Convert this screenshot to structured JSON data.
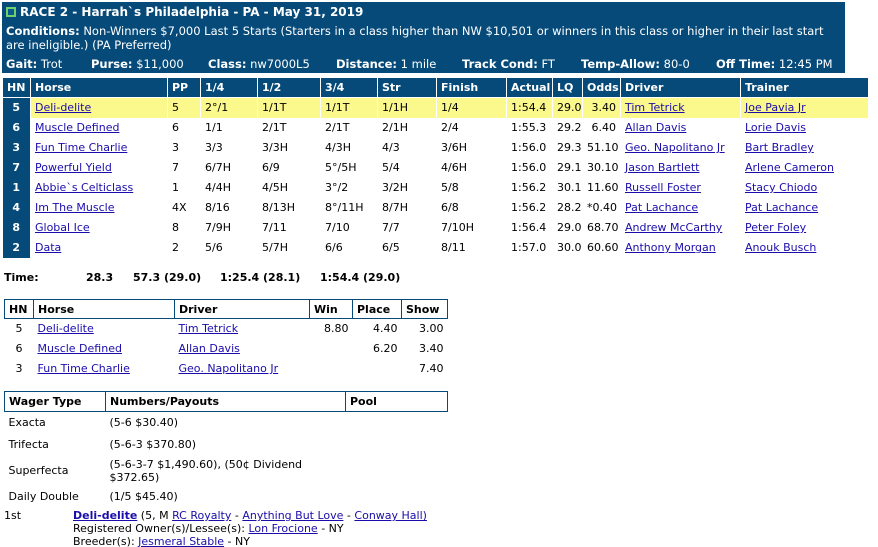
{
  "header": {
    "title": "RACE 2 - Harrah`s Philadelphia - PA - May 31, 2019",
    "conditions_label": "Conditions:",
    "conditions_text": "Non-Winners $7,000 Last 5 Starts (Starters in a class higher than NW $10,501 or winners in this class or higher in their last start are ineligible.) (PA Preferred)",
    "gait_label": "Gait:",
    "gait": "Trot",
    "purse_label": "Purse:",
    "purse": "$11,000",
    "class_label": "Class:",
    "class": "nw7000L5",
    "distance_label": "Distance:",
    "distance": "1 mile",
    "track_label": "Track Cond:",
    "track": "FT",
    "temp_label": "Temp-Allow:",
    "temp": "80-0",
    "off_label": "Off Time:",
    "off": "12:45 PM"
  },
  "results": {
    "columns": [
      "HN",
      "Horse",
      "PP",
      "1/4",
      "1/2",
      "3/4",
      "Str",
      "Finish",
      "Actual",
      "LQ",
      "Odds",
      "Driver",
      "Trainer"
    ],
    "rows": [
      {
        "hn": "5",
        "horse": "Deli-delite",
        "pp": "5",
        "q1": "2°/1",
        "q2": "1/1T",
        "q3": "1/1T",
        "str": "1/1H",
        "fin": "1/4",
        "actual": "1:54.4",
        "lq": "29.0",
        "odds": "3.40",
        "driver": "Tim Tetrick",
        "trainer": "Joe Pavia Jr"
      },
      {
        "hn": "6",
        "horse": "Muscle Defined",
        "pp": "6",
        "q1": "1/1",
        "q2": "2/1T",
        "q3": "2/1T",
        "str": "2/1H",
        "fin": "2/4",
        "actual": "1:55.3",
        "lq": "29.2",
        "odds": "6.40",
        "driver": "Allan Davis",
        "trainer": "Lorie Davis"
      },
      {
        "hn": "3",
        "horse": "Fun Time Charlie",
        "pp": "3",
        "q1": "3/3",
        "q2": "3/3H",
        "q3": "4/3H",
        "str": "4/3",
        "fin": "3/6H",
        "actual": "1:56.0",
        "lq": "29.3",
        "odds": "51.10",
        "driver": "Geo. Napolitano Jr",
        "trainer": "Bart Bradley"
      },
      {
        "hn": "7",
        "horse": "Powerful Yield",
        "pp": "7",
        "q1": "6/7H",
        "q2": "6/9",
        "q3": "5°/5H",
        "str": "5/4",
        "fin": "4/6H",
        "actual": "1:56.0",
        "lq": "29.1",
        "odds": "30.10",
        "driver": "Jason Bartlett",
        "trainer": "Arlene Cameron"
      },
      {
        "hn": "1",
        "horse": "Abbie`s Celticlass",
        "pp": "1",
        "q1": "4/4H",
        "q2": "4/5H",
        "q3": "3°/2",
        "str": "3/2H",
        "fin": "5/8",
        "actual": "1:56.2",
        "lq": "30.1",
        "odds": "11.60",
        "driver": "Russell Foster",
        "trainer": "Stacy Chiodo"
      },
      {
        "hn": "4",
        "horse": "Im The Muscle",
        "pp": "4X",
        "q1": "8/16",
        "q2": "8/13H",
        "q3": "8°/11H",
        "str": "8/7H",
        "fin": "6/8",
        "actual": "1:56.2",
        "lq": "28.2",
        "odds": "*0.40",
        "driver": "Pat Lachance",
        "trainer": "Pat Lachance"
      },
      {
        "hn": "8",
        "horse": "Global Ice",
        "pp": "8",
        "q1": "7/9H",
        "q2": "7/11",
        "q3": "7/10",
        "str": "7/7",
        "fin": "7/10H",
        "actual": "1:56.4",
        "lq": "29.0",
        "odds": "68.70",
        "driver": "Andrew McCarthy",
        "trainer": "Peter Foley"
      },
      {
        "hn": "2",
        "horse": "Data",
        "pp": "2",
        "q1": "5/6",
        "q2": "5/7H",
        "q3": "6/6",
        "str": "6/5",
        "fin": "8/11",
        "actual": "1:57.0",
        "lq": "30.0",
        "odds": "60.60",
        "driver": "Anthony Morgan",
        "trainer": "Anouk Busch"
      }
    ]
  },
  "times": {
    "label": "Time:",
    "splits": [
      "28.3",
      "57.3 (29.0)",
      "1:25.4 (28.1)",
      "1:54.4 (29.0)"
    ]
  },
  "payouts": {
    "columns": [
      "HN",
      "Horse",
      "Driver",
      "Win",
      "Place",
      "Show"
    ],
    "rows": [
      {
        "hn": "5",
        "horse": "Deli-delite",
        "driver": "Tim Tetrick",
        "win": "8.80",
        "place": "4.40",
        "show": "3.00"
      },
      {
        "hn": "6",
        "horse": "Muscle Defined",
        "driver": "Allan Davis",
        "win": "",
        "place": "6.20",
        "show": "3.40"
      },
      {
        "hn": "3",
        "horse": "Fun Time Charlie",
        "driver": "Geo. Napolitano Jr",
        "win": "",
        "place": "",
        "show": "7.40"
      }
    ]
  },
  "wagers": {
    "columns": [
      "Wager Type",
      "Numbers/Payouts",
      "Pool"
    ],
    "rows": [
      {
        "type": "Exacta",
        "payout": "(5-6 $30.40)",
        "pool": ""
      },
      {
        "type": "Trifecta",
        "payout": "(5-6-3 $370.80)",
        "pool": ""
      },
      {
        "type": "Superfecta",
        "payout": "(5-6-3-7 $1,490.60), (50¢ Dividend $372.65)",
        "pool": ""
      },
      {
        "type": "Daily Double",
        "payout": "(1/5 $45.40)",
        "pool": ""
      }
    ]
  },
  "finish": {
    "place": "1st",
    "horse": "Deli-delite",
    "detail": "(5, M",
    "sire": "RC Royalty",
    "sep1": "-",
    "dam": "Anything But Love",
    "sep2": "-",
    "damsire": "Conway Hall)",
    "owner_label": "Registered Owner(s)/Lessee(s):",
    "owner": "Lon Frocione",
    "owner_state": "- NY",
    "breeder_label": "Breeder(s):",
    "breeder": "Jesmeral Stable",
    "breeder_state": "- NY"
  }
}
